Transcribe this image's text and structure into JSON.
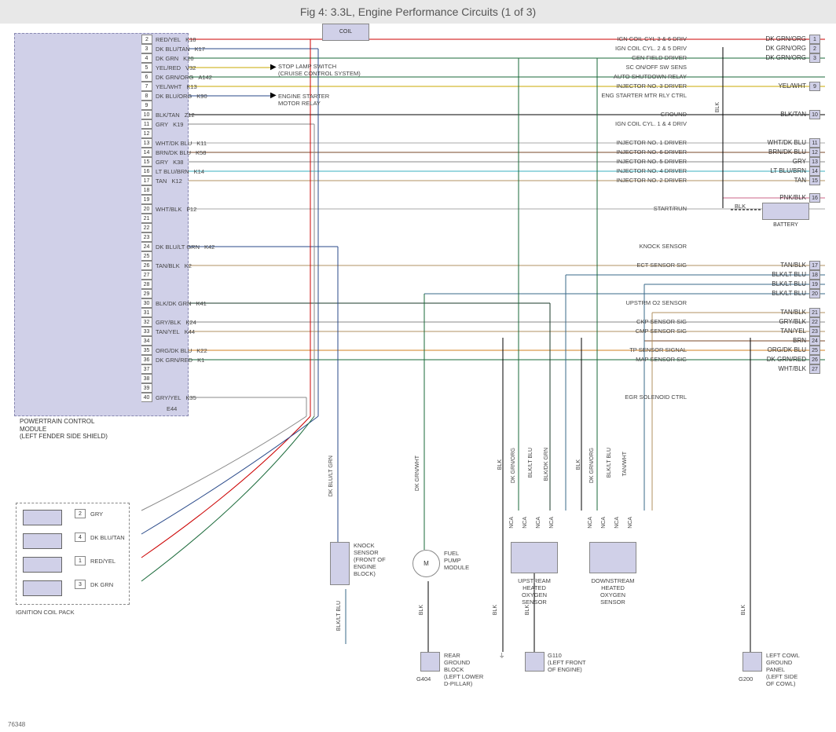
{
  "title": "Fig 4: 3.3L, Engine Performance Circuits (1 of 3)",
  "ref": "76348",
  "pcm": {
    "label_line1": "POWERTRAIN CONTROL",
    "label_line2": "MODULE",
    "label_line3": "(LEFT FENDER SIDE SHIELD)",
    "e44": "E44",
    "pins": [
      {
        "n": "2",
        "label": "IGN COIL CYL 3 & 6 DRIV",
        "wire": "RED/YEL",
        "code": "K18",
        "color": "#c00"
      },
      {
        "n": "3",
        "label": "IGN COIL CYL. 2 & 5 DRIV",
        "wire": "DK BLU/TAN",
        "code": "K17",
        "color": "#2a4a8a"
      },
      {
        "n": "4",
        "label": "GEN FIELD DRIVER",
        "wire": "DK GRN",
        "code": "K20",
        "color": "#1a6a3a"
      },
      {
        "n": "5",
        "label": "SC ON/OFF SW SENS",
        "wire": "YEL/RED",
        "code": "V32",
        "color": "#c9a800"
      },
      {
        "n": "6",
        "label": "AUTO SHUTDOWN RELAY",
        "wire": "DK GRN/ORG",
        "code": "A142",
        "color": "#1a6a3a"
      },
      {
        "n": "7",
        "label": "INJECTOR NO. 3 DRIVER",
        "wire": "YEL/WHT",
        "code": "K13",
        "color": "#c9a800"
      },
      {
        "n": "8",
        "label": "ENG STARTER MTR RLY CTRL",
        "wire": "DK BLU/ORG",
        "code": "K90",
        "color": "#2a4a8a"
      },
      {
        "n": "9",
        "label": "",
        "wire": "",
        "code": "",
        "color": ""
      },
      {
        "n": "10",
        "label": "GROUND",
        "wire": "BLK/TAN",
        "code": "Z12",
        "color": "#000"
      },
      {
        "n": "11",
        "label": "IGN COIL CYL. 1 & 4 DRIV",
        "wire": "GRY",
        "code": "K19",
        "color": "#888"
      },
      {
        "n": "12",
        "label": "",
        "wire": "",
        "code": "",
        "color": ""
      },
      {
        "n": "13",
        "label": "INJECTOR NO. 1 DRIVER",
        "wire": "WHT/DK BLU",
        "code": "K11",
        "color": "#aaa"
      },
      {
        "n": "14",
        "label": "INJECTOR NO. 6 DRIVER",
        "wire": "BRN/DK BLU",
        "code": "K58",
        "color": "#7a4a2a"
      },
      {
        "n": "15",
        "label": "INJECTOR NO. 5 DRIVER",
        "wire": "GRY",
        "code": "K38",
        "color": "#888"
      },
      {
        "n": "16",
        "label": "INJECTOR NO. 4 DRIVER",
        "wire": "LT BLU/BRN",
        "code": "K14",
        "color": "#3ab0c0"
      },
      {
        "n": "17",
        "label": "INJECTOR NO. 2 DRIVER",
        "wire": "TAN",
        "code": "K12",
        "color": "#b09060"
      },
      {
        "n": "18",
        "label": "",
        "wire": "",
        "code": "",
        "color": ""
      },
      {
        "n": "19",
        "label": "",
        "wire": "",
        "code": "",
        "color": ""
      },
      {
        "n": "20",
        "label": "START/RUN",
        "wire": "WHT/BLK",
        "code": "F12",
        "color": "#aaa"
      },
      {
        "n": "21",
        "label": "",
        "wire": "",
        "code": "",
        "color": ""
      },
      {
        "n": "22",
        "label": "",
        "wire": "",
        "code": "",
        "color": ""
      },
      {
        "n": "23",
        "label": "",
        "wire": "",
        "code": "",
        "color": ""
      },
      {
        "n": "24",
        "label": "KNOCK SENSOR",
        "wire": "DK BLU/LT GRN",
        "code": "K42",
        "color": "#2a4a8a"
      },
      {
        "n": "25",
        "label": "",
        "wire": "",
        "code": "",
        "color": ""
      },
      {
        "n": "26",
        "label": "ECT SENSOR SIG",
        "wire": "TAN/BLK",
        "code": "K2",
        "color": "#b09060"
      },
      {
        "n": "27",
        "label": "",
        "wire": "",
        "code": "",
        "color": ""
      },
      {
        "n": "28",
        "label": "",
        "wire": "",
        "code": "",
        "color": ""
      },
      {
        "n": "29",
        "label": "",
        "wire": "",
        "code": "",
        "color": ""
      },
      {
        "n": "30",
        "label": "UPSTRM O2 SENSOR",
        "wire": "BLK/DK GRN",
        "code": "K41",
        "color": "#1a3a2a"
      },
      {
        "n": "31",
        "label": "",
        "wire": "",
        "code": "",
        "color": ""
      },
      {
        "n": "32",
        "label": "CKP SENSOR SIG",
        "wire": "GRY/BLK",
        "code": "K24",
        "color": "#888"
      },
      {
        "n": "33",
        "label": "CMP SENSOR SIG",
        "wire": "TAN/YEL",
        "code": "K44",
        "color": "#b09060"
      },
      {
        "n": "34",
        "label": "",
        "wire": "",
        "code": "",
        "color": ""
      },
      {
        "n": "35",
        "label": "TP SENSOR SIGNAL",
        "wire": "ORG/DK BLU",
        "code": "K22",
        "color": "#d08020"
      },
      {
        "n": "36",
        "label": "MAP SENSOR SIG",
        "wire": "DK GRN/RED",
        "code": "K1",
        "color": "#1a6a3a"
      },
      {
        "n": "37",
        "label": "",
        "wire": "",
        "code": "",
        "color": ""
      },
      {
        "n": "38",
        "label": "",
        "wire": "",
        "code": "",
        "color": ""
      },
      {
        "n": "39",
        "label": "",
        "wire": "",
        "code": "",
        "color": ""
      },
      {
        "n": "40",
        "label": "EGR SOLENOID CTRL",
        "wire": "GRY/YEL",
        "code": "K35",
        "color": "#888"
      }
    ]
  },
  "top_coil": "COIL",
  "right": [
    {
      "wire": "DK GRN/ORG",
      "n": "1"
    },
    {
      "wire": "DK GRN/ORG",
      "n": "2"
    },
    {
      "wire": "DK GRN/ORG",
      "n": "3"
    },
    {
      "wire": "",
      "n": ""
    },
    {
      "wire": "YEL/WHT",
      "n": "9"
    },
    {
      "wire": "",
      "n": ""
    },
    {
      "wire": "BLK/TAN",
      "n": "10"
    },
    {
      "wire": "",
      "n": ""
    },
    {
      "wire": "WHT/DK BLU",
      "n": "11"
    },
    {
      "wire": "BRN/DK BLU",
      "n": "12"
    },
    {
      "wire": "GRY",
      "n": "13"
    },
    {
      "wire": "LT BLU/BRN",
      "n": "14"
    },
    {
      "wire": "TAN",
      "n": "15"
    },
    {
      "wire": "",
      "n": ""
    },
    {
      "wire": "PNK/BLK",
      "n": "16"
    },
    {
      "wire": "",
      "n": ""
    },
    {
      "wire": "TAN/BLK",
      "n": "17"
    },
    {
      "wire": "BLK/LT BLU",
      "n": "18"
    },
    {
      "wire": "BLK/LT BLU",
      "n": "19"
    },
    {
      "wire": "BLK/LT BLU",
      "n": "20"
    },
    {
      "wire": "",
      "n": ""
    },
    {
      "wire": "TAN/BLK",
      "n": "21"
    },
    {
      "wire": "GRY/BLK",
      "n": "22"
    },
    {
      "wire": "TAN/YEL",
      "n": "23"
    },
    {
      "wire": "BRN",
      "n": "24"
    },
    {
      "wire": "ORG/DK BLU",
      "n": "25"
    },
    {
      "wire": "DK GRN/RED",
      "n": "26"
    },
    {
      "wire": "WHT/BLK",
      "n": "27"
    }
  ],
  "annotations": {
    "stop_lamp": "STOP LAMP SWITCH\n(CRUISE CONTROL SYSTEM)",
    "starter": "ENGINE STARTER\nMOTOR RELAY",
    "blk": "BLK",
    "battery": "BATTERY",
    "knock": "KNOCK\nSENSOR\n(FRONT OF\nENGINE\nBLOCK)",
    "fuel": "FUEL\nPUMP\nMODULE",
    "rear_gnd": "REAR\nGROUND\nBLOCK\n(LEFT LOWER\nD-PILLAR)",
    "g404": "G404",
    "g110_label": "G110\n(LEFT FRONT\nOF ENGINE)",
    "g200": "G200",
    "left_cowl": "LEFT COWL\nGROUND\nPANEL\n(LEFT SIDE\nOF COWL)",
    "upstream": "UPSTREAM\nHEATED\nOXYGEN\nSENSOR",
    "downstream": "DOWNSTREAM\nHEATED\nOXYGEN\nSENSOR",
    "nca": "NCA",
    "m": "M"
  },
  "coil": {
    "label": "IGNITION COIL PACK",
    "pins": [
      {
        "n": "2",
        "wire": "GRY",
        "color": "#888"
      },
      {
        "n": "4",
        "wire": "DK BLU/TAN",
        "color": "#2a4a8a"
      },
      {
        "n": "1",
        "wire": "RED/YEL",
        "color": "#c00"
      },
      {
        "n": "3",
        "wire": "DK GRN",
        "color": "#1a6a3a"
      }
    ]
  },
  "vert_wires": {
    "knock_up": "DK BLU/LT GRN",
    "knock_down": "BLK/LT BLU",
    "fuel_up": "DK GRN/WHT",
    "fuel_down": "BLK",
    "o2_1": "BLK",
    "o2_2": "DK GRN/ORG",
    "o2_3": "BLK/LT BLU",
    "o2_4": "BLK/DK GRN",
    "o2d_1": "BLK",
    "o2d_2": "DK GRN/ORG",
    "o2d_3": "BLK/LT BLU",
    "o2d_4": "TAN/WHT",
    "g200_blk": "BLK",
    "g110_blk": "BLK",
    "extra_blk": "BLK"
  }
}
